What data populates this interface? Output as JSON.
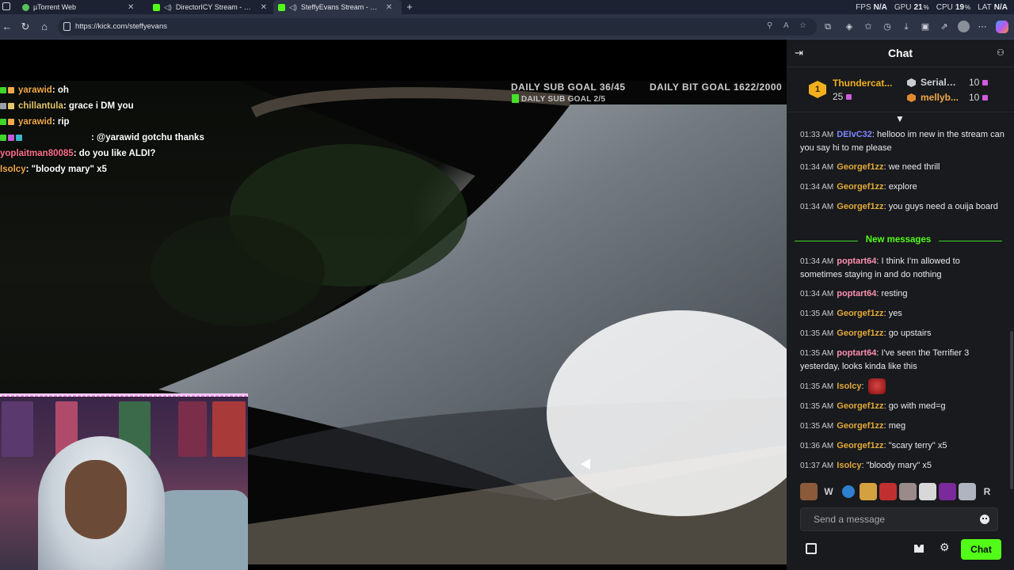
{
  "browser": {
    "tabs": [
      {
        "title": "µTorrent Web",
        "fav_color": "#58c35a",
        "sound": false,
        "active": false
      },
      {
        "title": "DirectorICY Stream - Watch Live on Kick",
        "fav_color": "#53fc18",
        "sound": true,
        "active": false
      },
      {
        "title": "SteffyEvans Stream - Watch Live on Kick",
        "fav_color": "#53fc18",
        "sound": true,
        "active": true
      }
    ],
    "url": "https://kick.com/steffyevans",
    "perf": {
      "fps_label": "FPS",
      "fps": "N/A",
      "gpu_label": "GPU",
      "gpu": "21",
      "cpu_label": "CPU",
      "cpu": "19",
      "lat_label": "LAT",
      "lat": "N/A",
      "pct": "%"
    }
  },
  "video": {
    "sub_goal": "DAILY SUB GOAL   36/45",
    "sub_goal_sub": "DAILY SUB GOAL   2/5",
    "bit_goal": "DAILY BIT GOAL      1622/2000",
    "overlay_chat": [
      {
        "user": "yarawid",
        "color": "#f0a94a",
        "text": ": oh",
        "badges": [
          "#3fd62a",
          "#f0a94a"
        ]
      },
      {
        "user": "chillantula",
        "color": "#e3c66a",
        "text": ": grace i DM you",
        "badges": [
          "#9aa0a8",
          "#e3c66a"
        ]
      },
      {
        "user": "yarawid",
        "color": "#f0a94a",
        "text": ": rip",
        "badges": [
          "#3fd62a",
          "#f0a94a"
        ]
      },
      {
        "user": "",
        "color": "#3a3fcf",
        "text": ": @yarawid gotchu thanks",
        "badges": [
          "#3fd62a",
          "#c25ad8",
          "#38b7c9"
        ]
      },
      {
        "user": "yoplaitman80085",
        "color": "#ff6f8f",
        "text": ": do you like ALDI?",
        "badges": []
      },
      {
        "user": "Isolcy",
        "color": "#f0a94a",
        "text": ": \"bloody mary\" x5",
        "badges": []
      }
    ]
  },
  "chat": {
    "title": "Chat",
    "leaderboard": {
      "first": {
        "rank": "1",
        "name": "Thundercat...",
        "count": "25"
      },
      "second": {
        "name": "SerialG...",
        "count": "10"
      },
      "third": {
        "name": "mellyb...",
        "count": "10"
      }
    },
    "new_messages_label": "New messages",
    "messages_before": [
      {
        "time": "01:33 AM",
        "user": "DElvC32",
        "color": "#7f86ff",
        "text": "hellooo im new in the stream can you say hi to me please"
      },
      {
        "time": "01:34 AM",
        "user": "Georgef1zz",
        "color": "#e3a93a",
        "text": "we need thrill"
      },
      {
        "time": "01:34 AM",
        "user": "Georgef1zz",
        "color": "#e3a93a",
        "text": "explore"
      },
      {
        "time": "01:34 AM",
        "user": "Georgef1zz",
        "color": "#e3a93a",
        "text": "you guys need a ouija board"
      }
    ],
    "messages_after": [
      {
        "time": "01:34 AM",
        "user": "poptart64",
        "color": "#ff8fb0",
        "text": "I think I'm allowed to sometimes staying in and do nothing"
      },
      {
        "time": "01:34 AM",
        "user": "poptart64",
        "color": "#ff8fb0",
        "text": "resting"
      },
      {
        "time": "01:35 AM",
        "user": "Georgef1zz",
        "color": "#e3a93a",
        "text": "yes"
      },
      {
        "time": "01:35 AM",
        "user": "Georgef1zz",
        "color": "#e3a93a",
        "text": "go upstairs"
      },
      {
        "time": "01:35 AM",
        "user": "poptart64",
        "color": "#ff8fb0",
        "text": "I've seen the Terrifier 3 yesterday, looks kinda like this"
      },
      {
        "time": "01:35 AM",
        "user": "Isolcy",
        "color": "#e3a93a",
        "text": "",
        "emote": true
      },
      {
        "time": "01:35 AM",
        "user": "Georgef1zz",
        "color": "#e3a93a",
        "text": "go with med=g"
      },
      {
        "time": "01:35 AM",
        "user": "Georgef1zz",
        "color": "#e3a93a",
        "text": "meg"
      },
      {
        "time": "01:36 AM",
        "user": "Georgef1zz",
        "color": "#e3a93a",
        "text": "\"scary terry\" x5"
      },
      {
        "time": "01:37 AM",
        "user": "Isolcy",
        "color": "#e3a93a",
        "text": "\"bloody mary\" x5"
      }
    ],
    "emote_bar": [
      "",
      "W",
      "",
      "",
      "",
      "",
      "",
      "",
      "",
      "R"
    ],
    "input_placeholder": "Send a message",
    "send_label": "Chat"
  },
  "colors": {
    "kick_green": "#53fc18",
    "chat_bg": "#181a1d"
  }
}
